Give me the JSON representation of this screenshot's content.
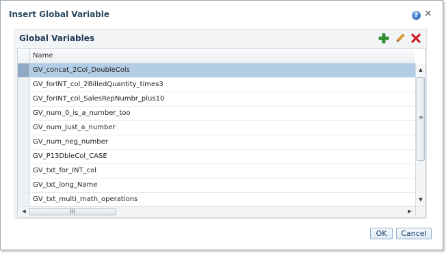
{
  "dialog": {
    "title": "Insert Global Variable",
    "help_icon": "question-circle-icon",
    "close_icon": "close-x-icon",
    "close_glyph": "✕",
    "help_glyph": "?"
  },
  "panel": {
    "title": "Global Variables",
    "tools": [
      {
        "name": "add-icon",
        "color": "#2e9a2e"
      },
      {
        "name": "edit-pencil-icon",
        "color": "#e0931b"
      },
      {
        "name": "delete-x-icon",
        "color": "#cc1f1f"
      }
    ]
  },
  "table": {
    "columns": [
      "Name"
    ],
    "rows": [
      "GV_concat_2Col_DoubleCols",
      "GV_forINT_col_2BilledQuantity_times3",
      "GV_forINT_col_SalesRepNumbr_plus10",
      "GV_num_0_is_a_number_too",
      "GV_num_Just_a_number",
      "GV_num_neg_number",
      "GV_P13DbleCol_CASE",
      "GV_txt_for_INT_col",
      "GV_txt_long_Name",
      "GV_txt_multi_math_operations"
    ],
    "selected_index": 0
  },
  "scroll": {
    "up": "▲",
    "down": "▼",
    "left": "◀",
    "right": "▶",
    "v_grip": "≡",
    "h_grip": "III"
  },
  "buttons": {
    "ok": "OK",
    "cancel": "Cancel"
  }
}
